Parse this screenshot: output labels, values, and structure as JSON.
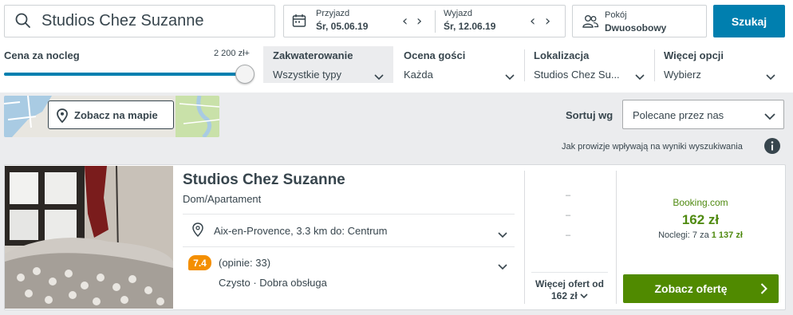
{
  "search": {
    "destination": "Studios Chez Suzanne"
  },
  "dates": {
    "checkin_label": "Przyjazd",
    "checkin_value": "Śr, 05.06.19",
    "checkout_label": "Wyjazd",
    "checkout_value": "Śr, 12.06.19"
  },
  "rooms": {
    "label": "Pokój",
    "value": "Dwuosobowy"
  },
  "search_button": "Szukaj",
  "price_filter": {
    "label": "Cena za nocleg",
    "max": "2 200 zł+",
    "level_percent": 100
  },
  "filters": [
    {
      "label": "Zakwaterowanie",
      "value": "Wszystkie typy"
    },
    {
      "label": "Ocena gości",
      "value": "Każda"
    },
    {
      "label": "Lokalizacja",
      "value": "Studios Chez Su..."
    },
    {
      "label": "Więcej opcji",
      "value": "Wybierz"
    }
  ],
  "map_button": "Zobacz na mapie",
  "sort": {
    "label": "Sortuj wg",
    "value": "Polecane przez nas"
  },
  "commission_note": "Jak prowizje wpływają na wyniki wyszukiwania",
  "hotel": {
    "name": "Studios Chez Suzanne",
    "type": "Dom/Apartament",
    "location": "Aix-en-Provence, 3.3 km do: Centrum",
    "rating": "7.4",
    "reviews": "(opinie: 33)",
    "tags": "Czysto · Dobra obsługa"
  },
  "alt_offers": [
    "–",
    "–",
    "–"
  ],
  "more_offers": {
    "line1": "Więcej ofert od",
    "line2": "162 zł"
  },
  "best_offer": {
    "site": "Booking.com",
    "price": "162 zł",
    "nights_prefix": "Noclegi: 7 za",
    "nights_total": "1 137 zł",
    "button": "Zobacz ofertę"
  },
  "colors": {
    "accent": "#007faf",
    "deal_green": "#508a00",
    "rating_orange": "#f48f00"
  }
}
